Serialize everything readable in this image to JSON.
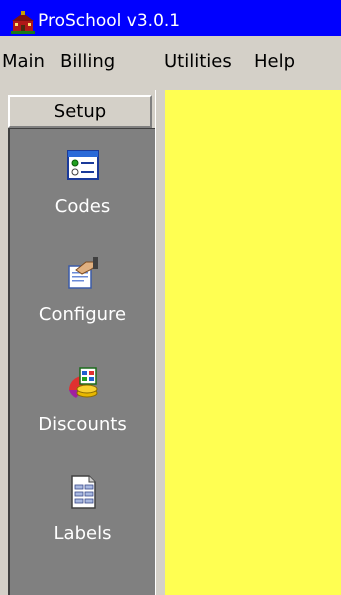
{
  "window": {
    "title": "ProSchool v3.0.1",
    "app_icon": "schoolhouse-icon"
  },
  "menubar": {
    "items": [
      {
        "label": "Main"
      },
      {
        "label": "Billing"
      },
      {
        "label": "Utilities"
      },
      {
        "label": "Help"
      }
    ]
  },
  "sidebar": {
    "header": "Setup",
    "items": [
      {
        "label": "Codes",
        "icon": "list-window-icon"
      },
      {
        "label": "Configure",
        "icon": "configure-hand-icon"
      },
      {
        "label": "Discounts",
        "icon": "discount-chart-icon"
      },
      {
        "label": "Labels",
        "icon": "document-labels-icon"
      }
    ]
  },
  "colors": {
    "titlebar": "#0000ff",
    "sidebar": "#808080",
    "content": "#ffff52",
    "chrome": "#d4d0c8"
  }
}
